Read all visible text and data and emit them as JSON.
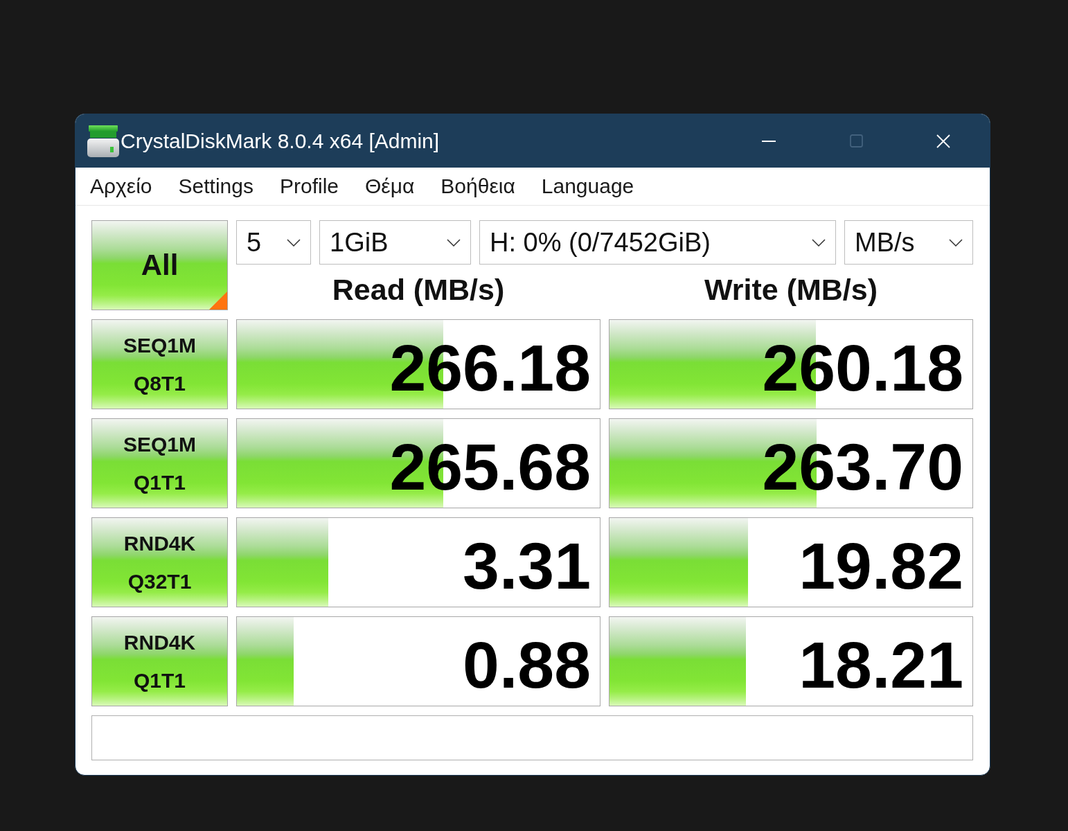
{
  "window": {
    "title": "CrystalDiskMark 8.0.4 x64 [Admin]",
    "controls": [
      {
        "kind": "minimize",
        "disabled": false
      },
      {
        "kind": "maximize",
        "disabled": true
      },
      {
        "kind": "close",
        "disabled": false
      }
    ]
  },
  "menu": [
    "Αρχείο",
    "Settings",
    "Profile",
    "Θέμα",
    "Βοήθεια",
    "Language"
  ],
  "toolbar": {
    "all_button": "All",
    "selects": [
      {
        "value": "5"
      },
      {
        "value": "1GiB"
      },
      {
        "value": "H: 0% (0/7452GiB)"
      },
      {
        "value": "MB/s"
      }
    ]
  },
  "columns": [
    "Read (MB/s)",
    "Write (MB/s)"
  ],
  "tests": [
    {
      "label": [
        "SEQ1M",
        "Q8T1"
      ],
      "read": {
        "reading": "266.18",
        "level": 0.568
      },
      "write": {
        "reading": "260.18",
        "level": 0.568
      }
    },
    {
      "label": [
        "SEQ1M",
        "Q1T1"
      ],
      "read": {
        "reading": "265.68",
        "level": 0.568
      },
      "write": {
        "reading": "263.70",
        "level": 0.57
      }
    },
    {
      "label": [
        "RND4K",
        "Q32T1"
      ],
      "read": {
        "reading": "3.31",
        "level": 0.251
      },
      "write": {
        "reading": "19.82",
        "level": 0.382
      }
    },
    {
      "label": [
        "RND4K",
        "Q1T1"
      ],
      "read": {
        "reading": "0.88",
        "level": 0.156
      },
      "write": {
        "reading": "18.21",
        "level": 0.375
      }
    }
  ]
}
